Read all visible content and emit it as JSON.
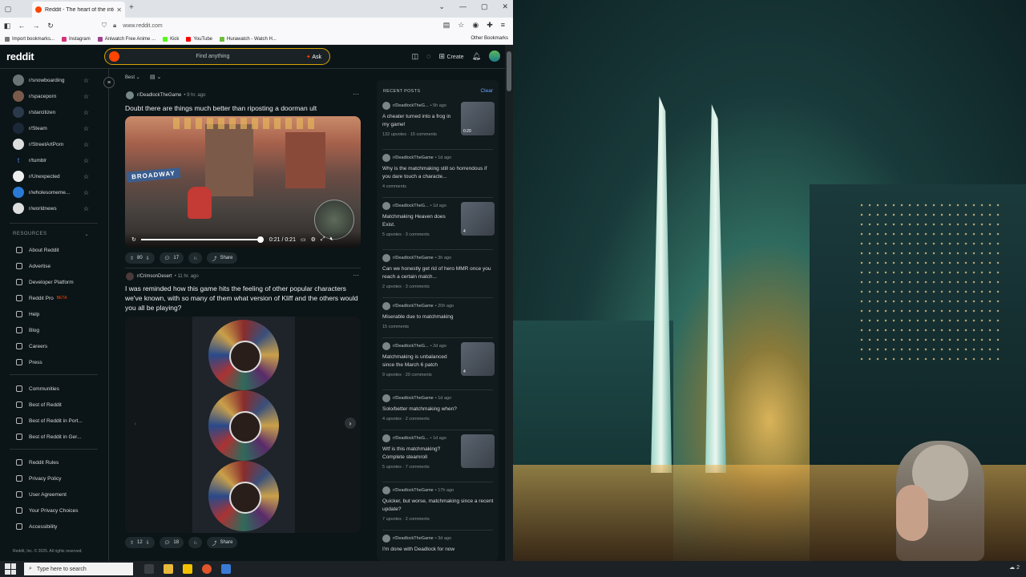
{
  "browser": {
    "tab_title": "Reddit - The heart of the intern",
    "url": "www.reddit.com",
    "bookmarks": [
      "Import bookmarks...",
      "Instagram",
      "Aniwatch Free Anime ...",
      "Kick",
      "YouTube",
      "Hurawatch - Watch H..."
    ],
    "other_bookmarks": "Other Bookmarks"
  },
  "header": {
    "logo": "reddit",
    "search_placeholder": "Find anything",
    "ask_label": "Ask",
    "create_label": "Create"
  },
  "sidebar": {
    "communities": [
      "r/snowboarding",
      "r/spaceporn",
      "r/starcitizen",
      "r/Steam",
      "r/StreetArtPorn",
      "r/tumblr",
      "r/Unexpected",
      "r/wholesomeme...",
      "r/worldnews"
    ],
    "resources_heading": "RESOURCES",
    "resources": [
      "About Reddit",
      "Advertise",
      "Developer Platform",
      "Reddit Pro",
      "Help",
      "Blog",
      "Careers",
      "Press"
    ],
    "beta_label": "BETA",
    "more": [
      "Communities",
      "Best of Reddit",
      "Best of Reddit in Port...",
      "Best of Reddit in Ger..."
    ],
    "legal": [
      "Reddit Rules",
      "Privacy Policy",
      "User Agreement",
      "Your Privacy Choices",
      "Accessibility"
    ],
    "copyright": "Reddit, Inc. © 2025. All rights reserved."
  },
  "feed": {
    "sort": "Best",
    "posts": [
      {
        "sub": "r/DeadlockTheGame",
        "age": "• 9 hr. ago",
        "title": "Doubt there are things much better than riposting a doorman ult",
        "video_sign": "BROADWAY",
        "video_time": "0:21 / 0:21",
        "votes": "80",
        "comments": "17",
        "share": "Share"
      },
      {
        "sub": "r/CrimsonDesert",
        "age": "• 11 hr. ago",
        "title": "I was reminded how this game hits the feeling of other popular characters we've known, with so many of them what version of Kliff and the others would you all be playing?",
        "votes": "12",
        "comments": "18",
        "share": "Share"
      }
    ]
  },
  "recent": {
    "heading": "RECENT POSTS",
    "clear": "Clear",
    "posts": [
      {
        "sub": "r/DeadlockTheG...",
        "age": "• 5h ago",
        "title": "A cheater turned into a frog in my game!",
        "stats": "132 upvotes · 15 comments",
        "thumb": true,
        "thumb_label": "0:20"
      },
      {
        "sub": "r/DeadlockTheGame",
        "age": "• 1d ago",
        "title": "Why is the matchmaking still so horrendous if you dare touch a characte...",
        "stats": "4 comments",
        "thumb": false
      },
      {
        "sub": "r/DeadlockTheG...",
        "age": "• 1d ago",
        "title": "Matchmaking Heaven does Exist.",
        "stats": "5 upvotes · 3 comments",
        "thumb": true,
        "thumb_label": "4"
      },
      {
        "sub": "r/DeadlockTheGame",
        "age": "• 3h ago",
        "title": "Can we honestly get rid of hero MMR once you reach a certain match...",
        "stats": "2 upvotes · 3 comments",
        "thumb": false
      },
      {
        "sub": "r/DeadlockTheGame",
        "age": "• 20h ago",
        "title": "Miserable due to matchmaking",
        "stats": "15 comments",
        "thumb": false
      },
      {
        "sub": "r/DeadlockTheG...",
        "age": "• 2d ago",
        "title": "Matchmaking is unbalanced since the March 6 patch",
        "stats": "9 upvotes · 20 comments",
        "thumb": true,
        "thumb_label": "4"
      },
      {
        "sub": "r/DeadlockTheGame",
        "age": "• 1d ago",
        "title": "Solo/better matchmaking when?",
        "stats": "4 upvotes · 2 comments",
        "thumb": false
      },
      {
        "sub": "r/DeadlockTheG...",
        "age": "• 1d ago",
        "title": "Wtf is this matchmaking? Complete steamroll",
        "stats": "5 upvotes · 7 comments",
        "thumb": true,
        "thumb_label": ""
      },
      {
        "sub": "r/DeadlockTheGame",
        "age": "• 17h ago",
        "title": "Quicker, but worse, matchmaking since a recent update?",
        "stats": "7 upvotes · 2 comments",
        "thumb": false
      },
      {
        "sub": "r/DeadlockTheGame",
        "age": "• 3d ago",
        "title": "I'm done with Deadlock for now",
        "stats": "",
        "thumb": false
      }
    ]
  },
  "taskbar": {
    "search_placeholder": "Type here to search"
  }
}
